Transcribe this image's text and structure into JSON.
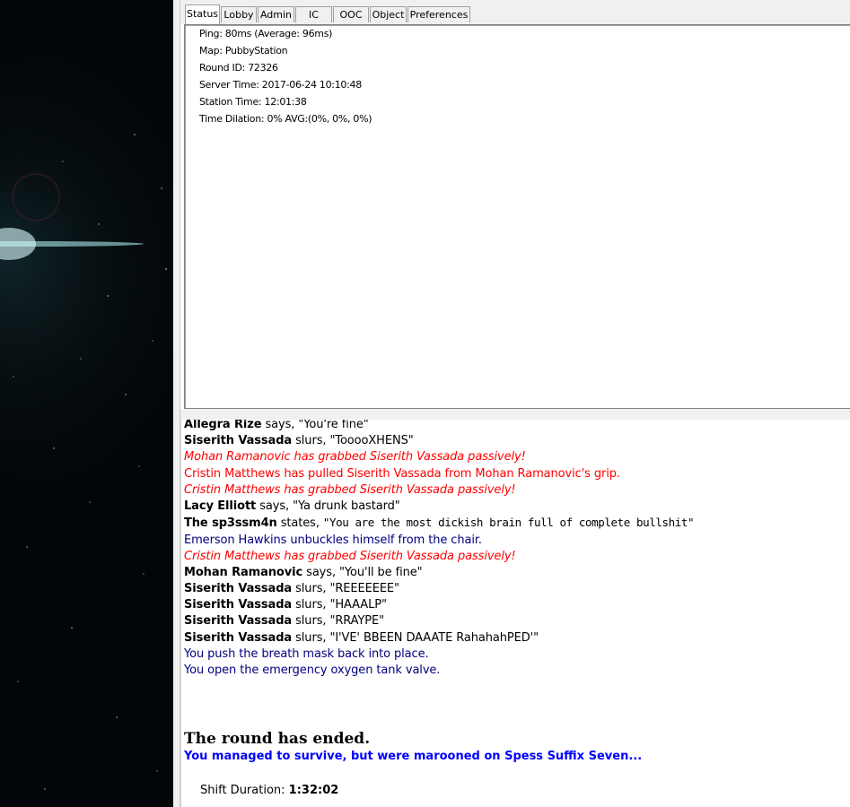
{
  "tabs": [
    "Status",
    "Lobby",
    "Admin",
    "IC",
    "OOC",
    "Object",
    "Preferences"
  ],
  "active_tab": "Status",
  "status": {
    "ping": "Ping: 80ms (Average: 96ms)",
    "map": "Map: PubbyStation",
    "round_id": "Round ID: 72326",
    "server_time": "Server Time: 2017-06-24 10:10:48",
    "station_time": "Station Time: 12:01:38",
    "time_dilation": "Time Dilation: 0% AVG:(0%, 0%, 0%)"
  },
  "chat": [
    {
      "speaker": "Allegra Rize",
      "verb": " says, ",
      "text": "\"You're fine\"",
      "style": "say"
    },
    {
      "speaker": "Siserith Vassada",
      "verb": " slurs, ",
      "text": "\"TooooXHENS\"",
      "style": "say"
    },
    {
      "text": "Mohan Ramanovic has grabbed Siserith Vassada passively!",
      "style": "red-i"
    },
    {
      "text": "Cristin Matthews has pulled Siserith Vassada from Mohan Ramanovic's grip.",
      "style": "red"
    },
    {
      "text": "Cristin Matthews has grabbed Siserith Vassada passively!",
      "style": "red-i"
    },
    {
      "speaker": "Lacy Elliott",
      "verb": " says, ",
      "text": "\"Ya drunk bastard\"",
      "style": "say"
    },
    {
      "speaker": "The sp3ssm4n",
      "verb": " states, ",
      "text": "\"You are the most dickish brain full of complete bullshit\"",
      "style": "mono"
    },
    {
      "text": "Emerson Hawkins unbuckles himself from the chair.",
      "style": "blue"
    },
    {
      "text": "Cristin Matthews has grabbed Siserith Vassada passively!",
      "style": "red-i"
    },
    {
      "speaker": "Mohan Ramanovic",
      "verb": " says, ",
      "text": "\"You'll be fine\"",
      "style": "say"
    },
    {
      "speaker": "Siserith Vassada",
      "verb": " slurs, ",
      "text": "\"REEEEEEE\"",
      "style": "say"
    },
    {
      "speaker": "Siserith Vassada",
      "verb": " slurs, ",
      "text": "\"HAAALP\"",
      "style": "say"
    },
    {
      "speaker": "Siserith Vassada",
      "verb": " slurs, ",
      "text": "\"RRAYPE\"",
      "style": "say"
    },
    {
      "speaker": "Siserith Vassada",
      "verb": " slurs, ",
      "text": "\"I'VE' BBEEN DAAATE RahahahPED'\"",
      "style": "say"
    },
    {
      "text": "You push the breath mask back into place.",
      "style": "blue"
    },
    {
      "text": "You open the emergency oxygen tank valve.",
      "style": "blue"
    }
  ],
  "round_end": {
    "title": "The round has ended.",
    "survival": "You managed to survive, but were marooned on Spess Suffix Seven...",
    "shift_label": "Shift Duration: ",
    "shift_value": "1:32:02"
  },
  "colors": {
    "red": "#ff0000",
    "blue": "#000080",
    "survival_blue": "#0000ff"
  }
}
